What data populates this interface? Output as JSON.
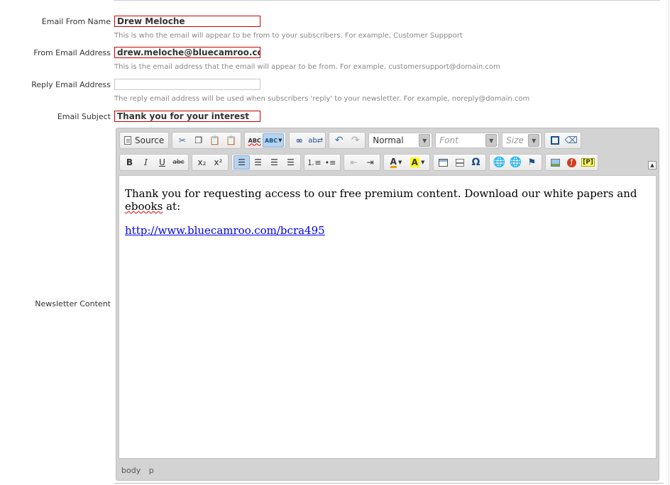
{
  "form": {
    "from_name": {
      "label": "Email From Name",
      "value": "Drew Meloche",
      "help": "This is who the email will appear to be from to your subscribers. For example, Customer Suppport"
    },
    "from_email": {
      "label": "From Email Address",
      "value": "drew.meloche@bluecamroo.co",
      "help": "This is the email address that the email will appear to be from. For example, customersupport@domain.com"
    },
    "reply_email": {
      "label": "Reply Email Address",
      "value": "",
      "help": "The reply email address will be used when subscribers 'reply' to your newsletter. For example, noreply@domain.com"
    },
    "subject": {
      "label": "Email Subject",
      "value": "Thank you for your interest"
    },
    "content_label": "Newsletter Content"
  },
  "toolbar": {
    "source_label": "Source",
    "format_value": "Normal",
    "font_placeholder": "Font",
    "size_placeholder": "Size",
    "bold": "B",
    "italic": "I",
    "underline": "U",
    "strike": "abc",
    "subscript": "x₂",
    "superscript": "x²",
    "spell": "ABC",
    "special_char": "Ω",
    "placeholder": "[P]"
  },
  "editor": {
    "paragraph1_a": "Thank you for requesting access to our free premium content. Download our white papers and ",
    "paragraph1_misspelled": "ebooks",
    "paragraph1_b": " at:",
    "link": "http://www.bluecamroo.com/bcra495",
    "path": [
      "body",
      "p"
    ]
  },
  "colors": {
    "error_border": "#cc0000",
    "link": "#0000ee",
    "editor_bg": "#d3d3d3"
  }
}
